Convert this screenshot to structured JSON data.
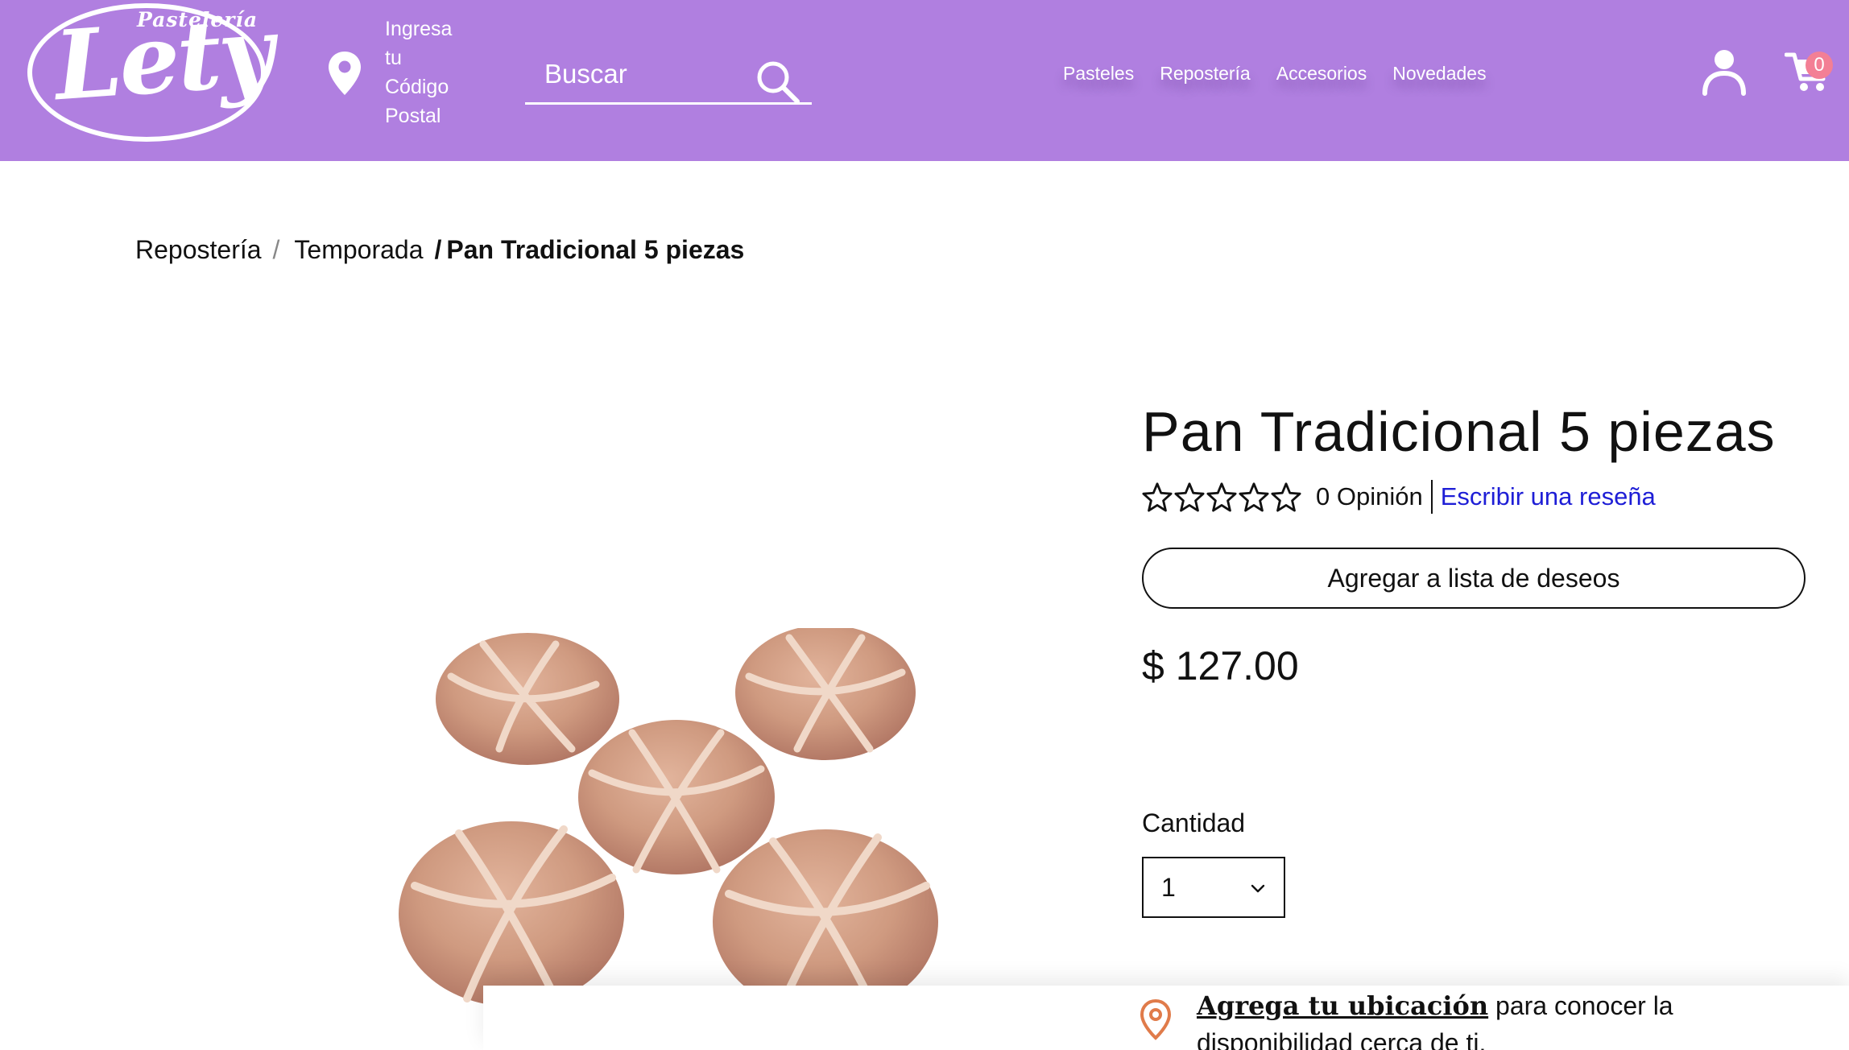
{
  "header": {
    "logo_small": "Pastelería",
    "logo_big": "Lety",
    "postal_prompt": [
      "Ingresa",
      "tu",
      "Código",
      "Postal"
    ],
    "search_placeholder": "Buscar",
    "nav": [
      {
        "label": "Pasteles"
      },
      {
        "label": "Repostería"
      },
      {
        "label": "Accesorios"
      },
      {
        "label": "Novedades"
      }
    ],
    "cart_count": "0",
    "colors": {
      "bar": "#b07fe0",
      "badge": "#f37f95"
    },
    "icons": [
      "map-pin-icon",
      "search-icon",
      "user-icon",
      "cart-icon"
    ]
  },
  "breadcrumb": {
    "items": [
      "Repostería",
      "Temporada"
    ],
    "separator": "/",
    "current": "Pan Tradicional 5 piezas"
  },
  "product": {
    "title": "Pan Tradicional 5 piezas",
    "rating": {
      "value": 0,
      "max": 5,
      "label": "0 Opinión",
      "review_link": "Escribir una reseña"
    },
    "wishlist_button": "Agregar a lista de deseos",
    "price": "$ 127.00",
    "quantity": {
      "label": "Cantidad",
      "value": "1"
    },
    "image_icon": "pan-de-muerto-image"
  },
  "location": {
    "link": "Agrega tu ubicación",
    "text": " para conocer la disponibilidad cerca de ti.",
    "icon": "location-pin-icon",
    "color": "#e07b4a"
  }
}
